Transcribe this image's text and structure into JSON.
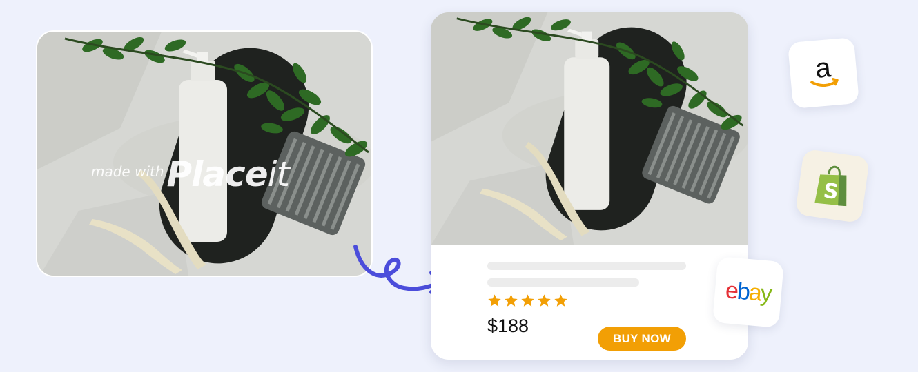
{
  "watermark": {
    "prefix": "made with",
    "brand_main": "Place",
    "brand_suffix": "it"
  },
  "product": {
    "rating": 5,
    "rating_max": 5,
    "price": "$188",
    "buy_label": "BUY NOW"
  },
  "marketplaces": {
    "amazon": {
      "text": "a"
    },
    "ebay": {
      "letters": [
        "e",
        "b",
        "a",
        "y"
      ]
    }
  },
  "colors": {
    "background": "#eef1fc",
    "accent_orange": "#f29f05",
    "star": "#f29f05",
    "arrow": "#4b4ddb",
    "ebay": [
      "#e53238",
      "#0064d2",
      "#f5af02",
      "#86b817"
    ],
    "shopify": "#95bf47"
  }
}
